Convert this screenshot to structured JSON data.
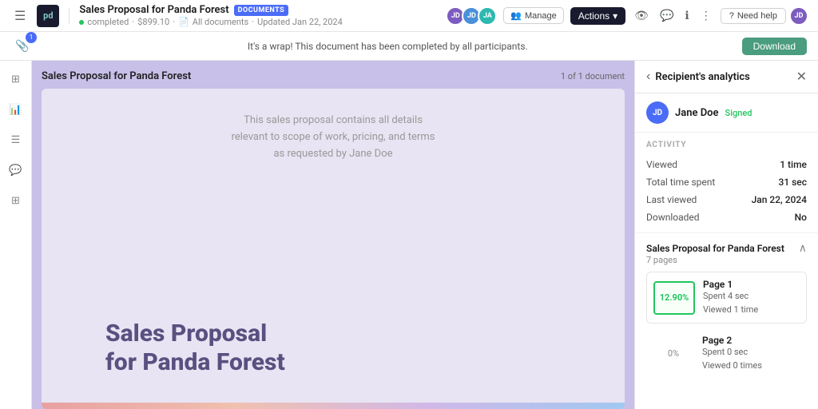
{
  "app": {
    "logo_text": "pd",
    "title": "Sales Proposal for Panda Forest",
    "doc_badge": "DOCUMENTS",
    "status": "completed",
    "price": "$899.10",
    "all_documents": "All documents",
    "updated": "Updated Jan 22, 2024"
  },
  "topbar": {
    "avatars": [
      {
        "initials": "JD",
        "color": "av-purple"
      },
      {
        "initials": "JD",
        "color": "av-blue"
      },
      {
        "initials": "JA",
        "color": "av-teal"
      }
    ],
    "manage_label": "Manage",
    "actions_label": "Actions",
    "need_help_label": "Need help"
  },
  "subbar": {
    "attachment_count": "1",
    "message": "It's a wrap! This document has been completed by all participants.",
    "download_label": "Download"
  },
  "document": {
    "title": "Sales Proposal for Panda Forest",
    "page_info": "1 of 1 document",
    "preview_text": "This sales proposal contains all details relevant to scope of work, pricing, and terms as requested by Jane Doe",
    "big_title_line1": "Sales Proposal",
    "big_title_line2": "for Panda Forest"
  },
  "right_panel": {
    "title": "Recipient's analytics",
    "recipient_initials": "JD",
    "recipient_name": "Jane Doe",
    "signed_label": "Signed",
    "activity_label": "ACTIVITY",
    "activity_rows": [
      {
        "label": "Viewed",
        "value": "1 time"
      },
      {
        "label": "Total time spent",
        "value": "31 sec"
      },
      {
        "label": "Last viewed",
        "value": "Jan 22, 2024"
      },
      {
        "label": "Downloaded",
        "value": "No"
      }
    ],
    "doc_section_title": "Sales Proposal for Panda Forest",
    "doc_section_pages": "7 pages",
    "page1": {
      "name": "Page 1",
      "percent": "12.90%",
      "spent": "Spent 4 sec",
      "viewed": "Viewed 1 time"
    },
    "page2": {
      "name": "Page 2",
      "percent": "0%",
      "spent": "Spent 0 sec",
      "viewed": "Viewed 0 times"
    }
  }
}
